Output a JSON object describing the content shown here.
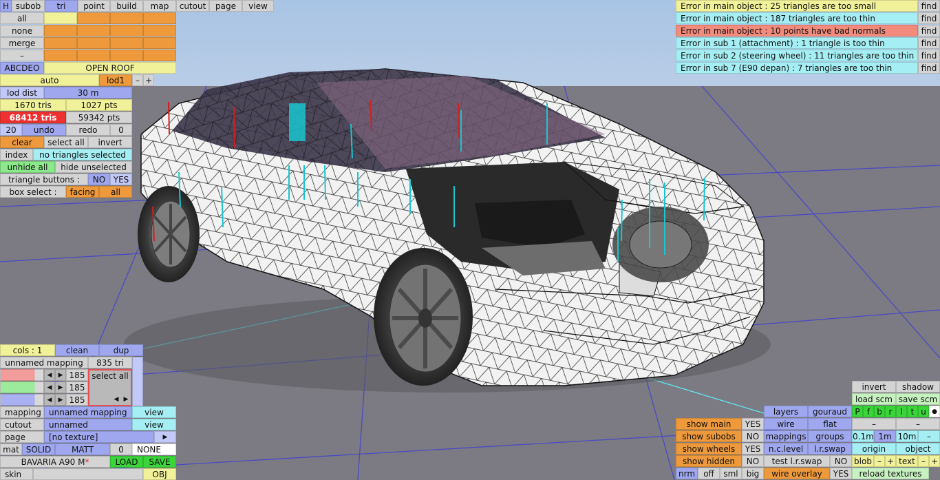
{
  "top_tabs": {
    "h": "H",
    "subob": "subob",
    "tri": "tri",
    "point": "point",
    "build": "build",
    "map": "map",
    "cutout": "cutout",
    "page": "page",
    "view": "view"
  },
  "select_rows": {
    "all": "all",
    "none": "none",
    "merge": "merge",
    "minus": "–"
  },
  "abcdeo": "ABCDEO",
  "open_roof": "OPEN ROOF",
  "lod": {
    "auto": "auto",
    "lod1": "lod1",
    "minus": "–",
    "plus": "+",
    "lod_dist": "lod dist",
    "lod_dist_value": "30 m"
  },
  "stats": {
    "tris": "1670 tris",
    "pts": "1027 pts",
    "total_tris": "68412 tris",
    "total_pts": "59342 pts"
  },
  "undo_row": {
    "count": "20",
    "undo": "undo",
    "redo": "redo",
    "redo_count": "0"
  },
  "sel_row": {
    "clear": "clear",
    "select_all": "select all",
    "invert": "invert"
  },
  "index_row": {
    "index": "index",
    "status": "no triangles selected"
  },
  "hide_row": {
    "unhide_all": "unhide all",
    "hide_unselected": "hide unselected"
  },
  "tri_buttons": {
    "label": "triangle buttons :",
    "no": "NO",
    "yes": "YES"
  },
  "box_select": {
    "label": "box select :",
    "facing": "facing",
    "all": "all"
  },
  "errors": [
    {
      "text": "Error in main object : 25 triangles are too small",
      "find": "find",
      "color": "#f1f19a"
    },
    {
      "text": "Error in main object : 187 triangles are too thin",
      "find": "find",
      "color": "#a5eef3"
    },
    {
      "text": "Error in main object : 10 points have bad normals",
      "find": "find",
      "color": "#f38b7c"
    },
    {
      "text": "Error in sub 1 (attachment) : 1 triangle is too thin",
      "find": "find",
      "color": "#a5eef3"
    },
    {
      "text": "Error in sub 2 (steering wheel) : 11 triangles are too thin",
      "find": "find",
      "color": "#a5eef3"
    },
    {
      "text": "Error in sub 7 (E90 depan) : 7 triangles are too thin",
      "find": "find",
      "color": "#a5eef3"
    }
  ],
  "mapping_panel": {
    "cols": "cols : 1",
    "clean": "clean",
    "dup": "dup",
    "unnamed_mapping": "unnamed mapping",
    "tri_count": "835 tri",
    "v1": "185",
    "v2": "185",
    "v3": "185",
    "select_all": "select all",
    "arrow_left": "◀",
    "arrow_right": "▶",
    "mapping_label": "mapping",
    "mapping_value": "unnamed mapping",
    "view1": "view",
    "cutout_label": "cutout",
    "cutout_value": "unnamed",
    "view2": "view",
    "page_label": "page",
    "page_value": "[no texture]",
    "page_arrow": "▶",
    "mat": "mat",
    "solid": "SOLID",
    "matt": "MATT",
    "zero": "0",
    "none": "NONE",
    "material_name": "BAVARIA A90 M",
    "asterisk": "*",
    "load": "LOAD",
    "save": "SAVE",
    "skin": "skin",
    "obj": "OBJ"
  },
  "view_panel": {
    "invert": "invert",
    "shadow": "shadow",
    "load_scm": "load scm",
    "save_scm": "save scm",
    "flags": [
      "P",
      "f",
      "b",
      "r",
      "l",
      "t",
      "u"
    ],
    "dot": "●",
    "dash1": "–",
    "dash2": "–",
    "layers": "layers",
    "gouraud": "gouraud",
    "show_main": "show main",
    "show_main_v": "YES",
    "wire": "wire",
    "flat": "flat",
    "show_subobs": "show subobs",
    "show_subobs_v": "NO",
    "mappings": "mappings",
    "groups": "groups",
    "d01": "0.1m",
    "d1": "1m",
    "d10": "10m",
    "dm": "–",
    "show_wheels": "show wheels",
    "show_wheels_v": "YES",
    "nc_level": "n.c.level",
    "lr_swap": "l.r.swap",
    "origin": "origin",
    "object": "object",
    "show_hidden": "show hidden",
    "show_hidden_v": "NO",
    "test_lr": "test l.r.swap",
    "test_lr_v": "NO",
    "blob": "blob",
    "blob_m": "–",
    "blob_p": "+",
    "text": "text",
    "text_m": "–",
    "text_p": "+",
    "nrm": "nrm",
    "off": "off",
    "sml": "sml",
    "big": "big",
    "wire_overlay": "wire overlay",
    "wire_overlay_v": "YES",
    "reload": "reload textures"
  }
}
